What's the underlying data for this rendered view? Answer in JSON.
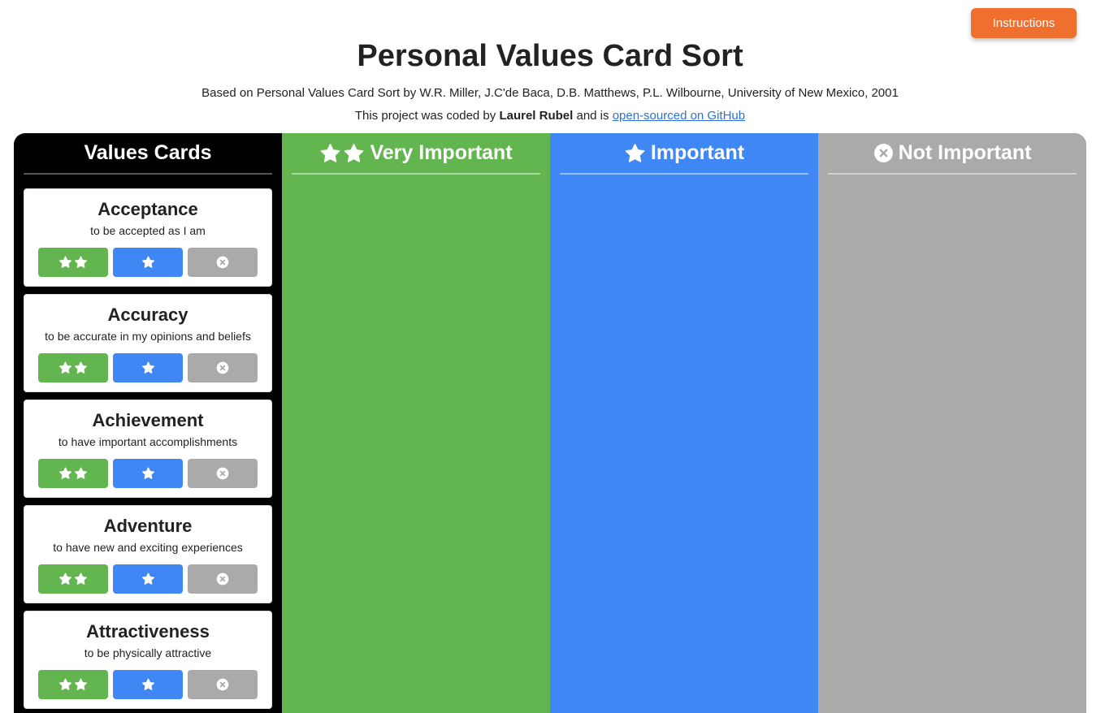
{
  "header": {
    "instructions_label": "Instructions",
    "title": "Personal Values Card Sort",
    "subtitle": "Based on Personal Values Card Sort by W.R. Miller, J.C'de Baca, D.B. Matthews, P.L. Wilbourne, University of New Mexico, 2001",
    "credit_prefix": "This project was coded by",
    "credit_author": "Laurel Rubel",
    "credit_middle": "and is",
    "credit_link": "open-sourced on GitHub"
  },
  "columns": {
    "values": {
      "label": "Values Cards",
      "color": "#000000"
    },
    "very": {
      "label": "Very Important",
      "color": "#63b64f",
      "icon": "two-stars-icon"
    },
    "important": {
      "label": "Important",
      "color": "#3f87f5",
      "icon": "star-icon"
    },
    "not": {
      "label": "Not Important",
      "color": "#aaaaaa",
      "icon": "circle-x-icon"
    }
  },
  "cards": [
    {
      "title": "Acceptance",
      "desc": "to be accepted as I am"
    },
    {
      "title": "Accuracy",
      "desc": "to be accurate in my opinions and beliefs"
    },
    {
      "title": "Achievement",
      "desc": "to have important accomplishments"
    },
    {
      "title": "Adventure",
      "desc": "to have new and exciting experiences"
    },
    {
      "title": "Attractiveness",
      "desc": "to be physically attractive"
    }
  ],
  "colors": {
    "accent_orange": "#ef6f2e",
    "green": "#63b64f",
    "blue": "#3f87f5",
    "gray": "#aaaaaa",
    "link": "#2f6fd6"
  }
}
